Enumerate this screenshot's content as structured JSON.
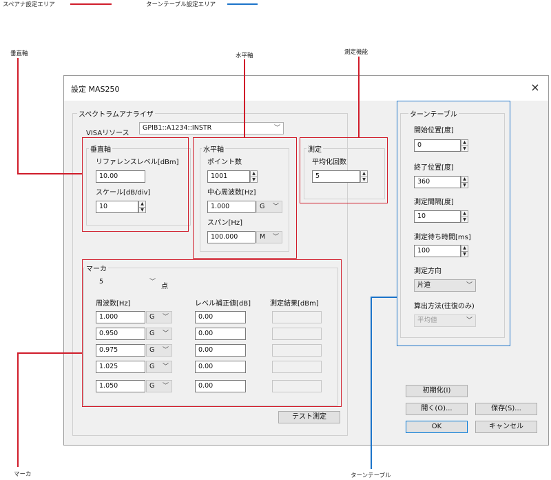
{
  "legend": {
    "spectrum_area": "スペアナ設定エリア",
    "turntable_area": "ターンテーブル設定エリア"
  },
  "callouts": {
    "vertical": "垂直軸",
    "horizontal": "水平軸",
    "measure": "測定機能",
    "marker": "マーカ",
    "turntable": "ターンテーブル"
  },
  "colors": {
    "spectrum": "#d01c2a",
    "turntable": "#1b73c9",
    "accent": "#0078d7"
  },
  "dialog": {
    "title": "設定 MAS250",
    "close": "×",
    "spectrum": {
      "group_label": "スペクトラムアナライザ",
      "visa_label": "VISAリソース",
      "visa_value": "GPIB1::A1234::INSTR",
      "vertical": {
        "label": "垂直軸",
        "ref_label": "リファレンスレベル[dBm]",
        "ref_value": "10.00",
        "scale_label": "スケール[dB/div]",
        "scale_value": "10"
      },
      "horizontal": {
        "label": "水平軸",
        "points_label": "ポイント数",
        "points_value": "1001",
        "center_label": "中心周波数[Hz]",
        "center_value": "1.000",
        "center_unit": "G",
        "span_label": "スパン[Hz]",
        "span_value": "100.000",
        "span_unit": "M"
      },
      "measure": {
        "label": "測定",
        "avg_label": "平均化回数",
        "avg_value": "5"
      },
      "marker": {
        "label": "マーカ",
        "count_value": "5",
        "count_unit": "点",
        "col_freq": "周波数[Hz]",
        "col_level": "レベル補正値[dB]",
        "col_result": "測定結果[dBm]",
        "rows": [
          {
            "freq": "1.000",
            "unit": "G",
            "level": "0.00",
            "result": ""
          },
          {
            "freq": "0.950",
            "unit": "G",
            "level": "0.00",
            "result": ""
          },
          {
            "freq": "0.975",
            "unit": "G",
            "level": "0.00",
            "result": ""
          },
          {
            "freq": "1.025",
            "unit": "G",
            "level": "0.00",
            "result": ""
          },
          {
            "freq": "1.050",
            "unit": "G",
            "level": "0.00",
            "result": ""
          }
        ]
      },
      "test_button": "テスト測定"
    },
    "turntable": {
      "group_label": "ターンテーブル",
      "start_label": "開始位置[度]",
      "start_value": "0",
      "end_label": "終了位置[度]",
      "end_value": "360",
      "interval_label": "測定間隔[度]",
      "interval_value": "10",
      "wait_label": "測定待ち時間[ms]",
      "wait_value": "100",
      "direction_label": "測定方向",
      "direction_value": "片道",
      "calc_label": "算出方法(往復のみ)",
      "calc_value": "平均値"
    },
    "buttons": {
      "init": "初期化(I)",
      "open": "開く(O)...",
      "save": "保存(S)...",
      "ok": "OK",
      "cancel": "キャンセル"
    }
  }
}
